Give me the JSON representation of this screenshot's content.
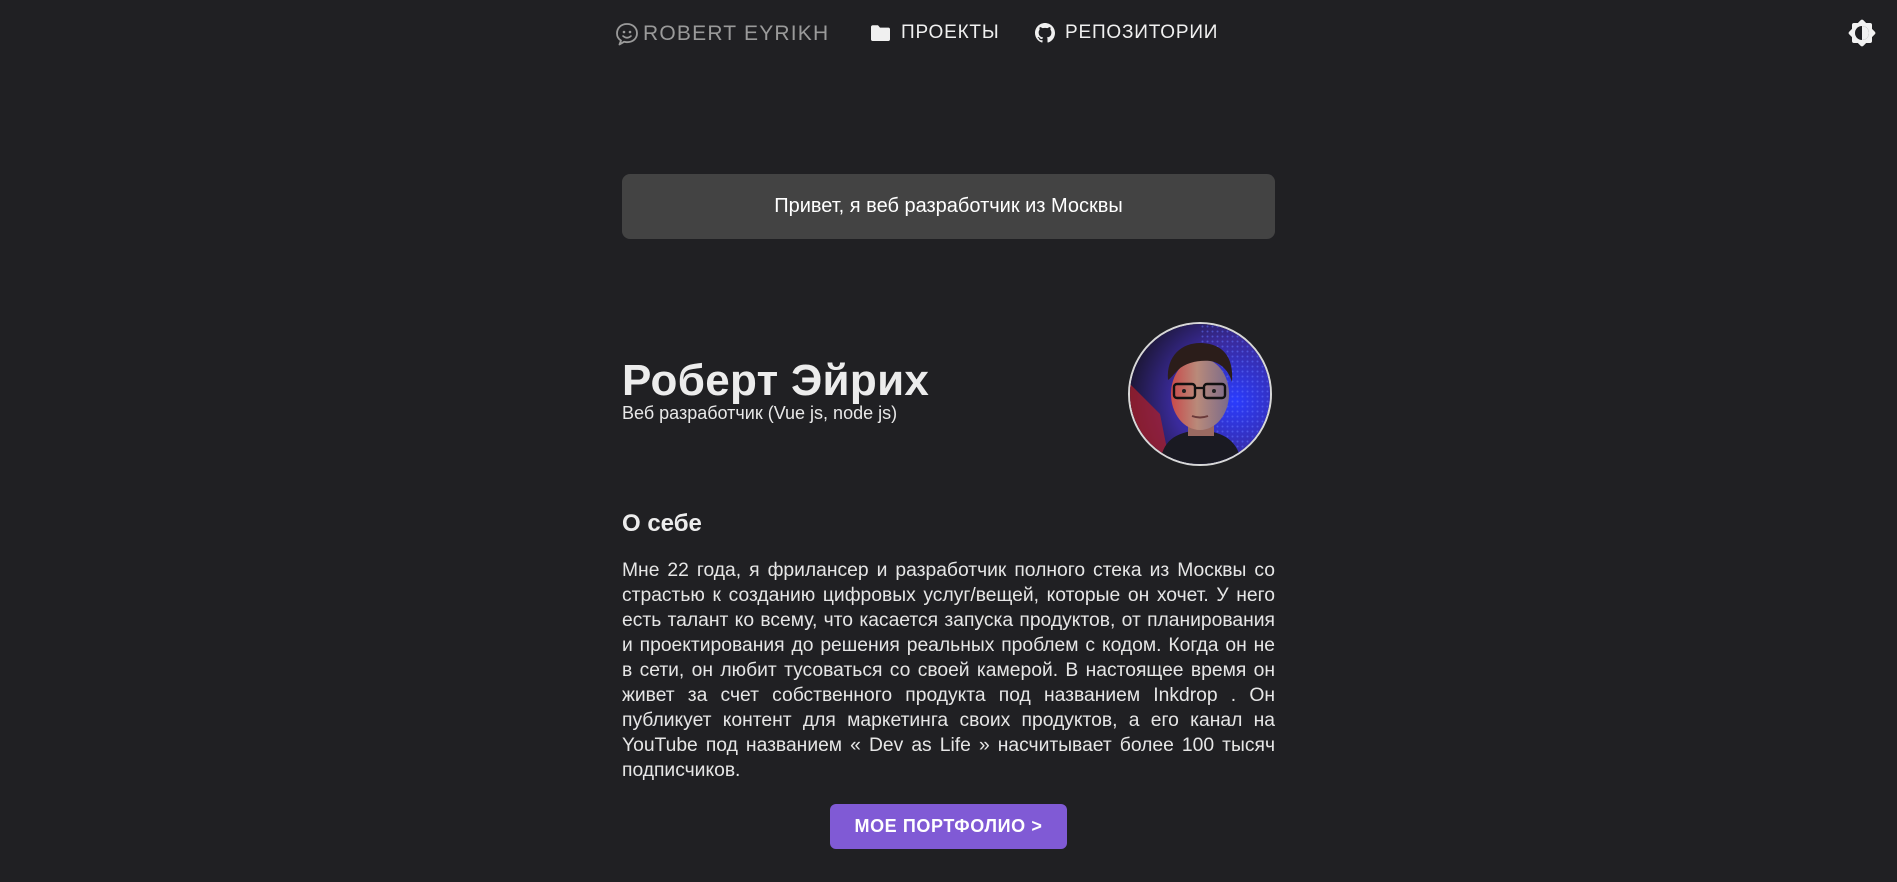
{
  "nav": {
    "brand": "ROBERT EYRIKH",
    "brand_icon": "smiley-chat-icon",
    "links": [
      {
        "label": "ПРОЕКТЫ",
        "icon": "folder-icon"
      },
      {
        "label": "РЕПОЗИТОРИИ",
        "icon": "github-icon"
      }
    ],
    "theme_toggle_icon": "sun-icon"
  },
  "greeting": "Привет, я веб разработчик из Москвы",
  "profile": {
    "name": "Роберт Эйрих",
    "role": "Веб разработчик (Vue js, node js)"
  },
  "about": {
    "title": "О себе",
    "text": "Мне 22 года, я фрилансер и разработчик полного стека из Москвы со страстью к созданию цифровых услуг/вещей, которые он хочет. У него есть талант ко всему, что касается запуска продуктов, от планирования и проектирования до решения реальных проблем с кодом. Когда он не в сети, он любит тусоваться со своей камерой. В настоящее время он живет за счет собственного продукта под названием Inkdrop . Он публикует контент для маркетинга своих продуктов, а его канал на YouTube под названием « Dev as Life » насчитывает более 100 тысяч подписчиков."
  },
  "cta": {
    "label": "МОЕ ПОРТФОЛИО >"
  },
  "colors": {
    "background": "#202023",
    "greeting_bg": "#434343",
    "accent": "#805ad5"
  }
}
